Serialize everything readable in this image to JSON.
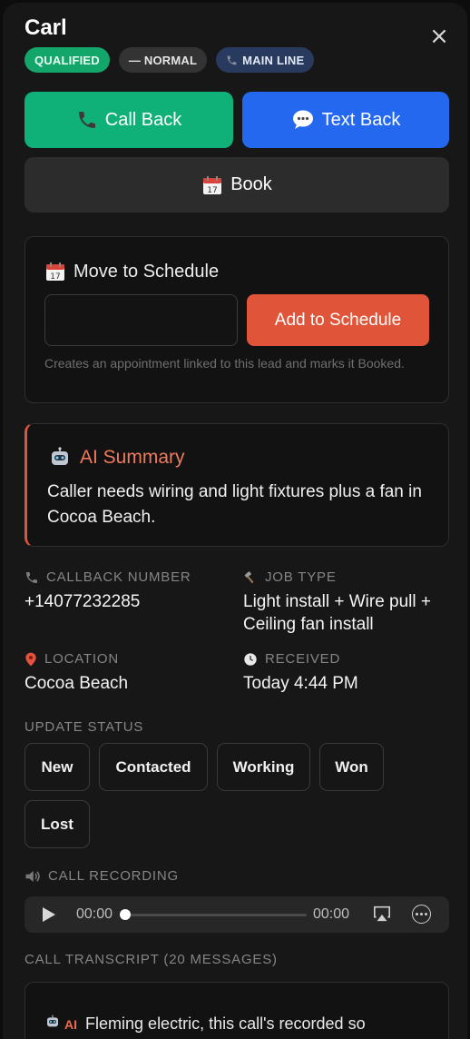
{
  "lead": {
    "name": "Carl",
    "close_glyph": "×",
    "badges": {
      "qualified": "QUALIFIED",
      "priority": "— NORMAL",
      "line": "MAIN LINE"
    }
  },
  "actions": {
    "call_back": "Call Back",
    "text_back": "Text Back",
    "book": "Book"
  },
  "schedule": {
    "title": "Move to Schedule",
    "input_value": "",
    "add_label": "Add to Schedule",
    "note": "Creates an appointment linked to this lead and marks it Booked."
  },
  "ai_summary": {
    "title": "AI Summary",
    "text": "Caller needs wiring and light fixtures plus a fan in Cocoa Beach."
  },
  "details": {
    "callback_label": "CALLBACK NUMBER",
    "callback_value": "+14077232285",
    "job_label": "JOB TYPE",
    "job_value": "Light install + Wire pull + Ceiling fan install",
    "location_label": "LOCATION",
    "location_value": "Cocoa Beach",
    "received_label": "RECEIVED",
    "received_value": "Today 4:44 PM"
  },
  "status": {
    "label": "UPDATE STATUS",
    "options": [
      "New",
      "Contacted",
      "Working",
      "Won",
      "Lost"
    ]
  },
  "recording": {
    "label": "CALL RECORDING",
    "current_time": "00:00",
    "duration": "00:00",
    "progress": 0
  },
  "transcript": {
    "label": "CALL TRANSCRIPT (20 MESSAGES)",
    "first_speaker": "AI",
    "first_message": "Fleming electric, this call's recorded so anything we talk about can be used back?"
  },
  "colors": {
    "qualified": "#13a66b",
    "call": "#10b178",
    "text": "#2468ef",
    "accent": "#e0553a"
  }
}
